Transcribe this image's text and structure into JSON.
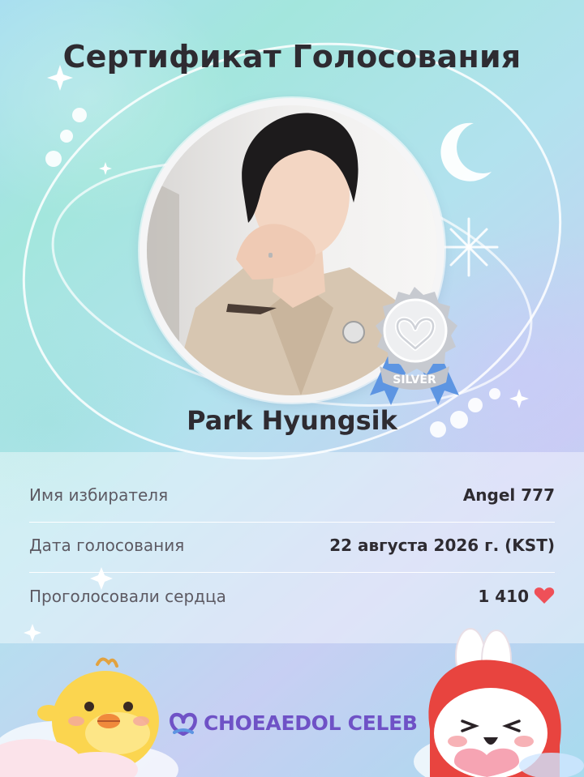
{
  "certificate": {
    "title": "Сертификат Голосования",
    "artist_name": "Park Hyungsik",
    "medal_label": "SILVER"
  },
  "info": {
    "voter_label": "Имя избирателя",
    "voter_value": "Angel 777",
    "date_label": "Дата голосования",
    "date_value": "22 августа 2026 г. (KST)",
    "hearts_label": "Проголосовали сердца",
    "hearts_value": "1 410"
  },
  "brand": {
    "logo_text": "CHOEAEDOL CELEB"
  },
  "colors": {
    "title": "#2e2b31",
    "heart": "#ef5058",
    "brand": "#6f52c6",
    "medal_ribbon": "#4f8de0",
    "medal_silver": "#c9ccd2"
  },
  "icons": {
    "heart": "heart-icon",
    "medal": "silver-medal-icon",
    "logo": "choeaedol-heart-logo-icon",
    "moon": "crescent-moon-icon",
    "sparkle": "sparkle-icon"
  }
}
